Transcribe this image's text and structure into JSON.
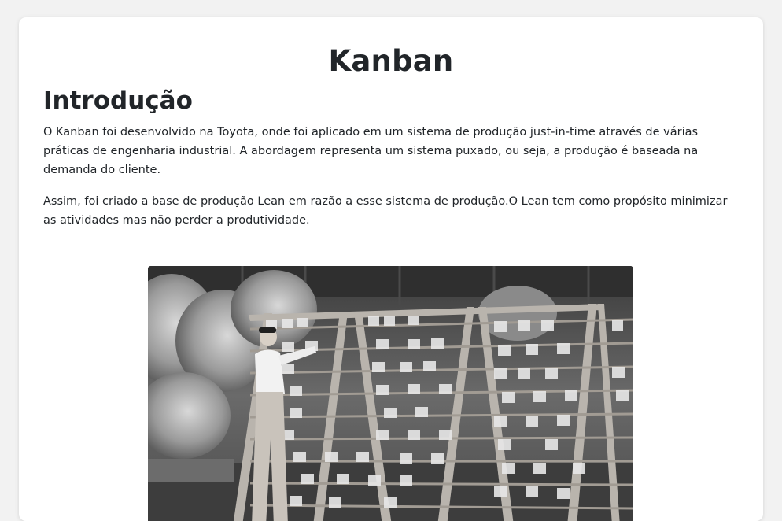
{
  "page": {
    "title": "Kanban"
  },
  "intro": {
    "heading": "Introdução",
    "paragraphs": [
      "O Kanban foi desenvolvido na Toyota, onde foi aplicado em um sistema de produção just-in-time através de várias práticas de engenharia industrial. A abordagem representa um sistema puxado, ou seja, a produção é baseada na demanda do cliente.",
      "Assim, foi criado a base de produção Lean em razão a esse sistema de produção.O Lean tem como propósito minimizar as atividades mas não perder a produtividade."
    ]
  },
  "photo": {
    "subject": "black-and-white photo of a worker at a kanban card rack in a factory"
  }
}
